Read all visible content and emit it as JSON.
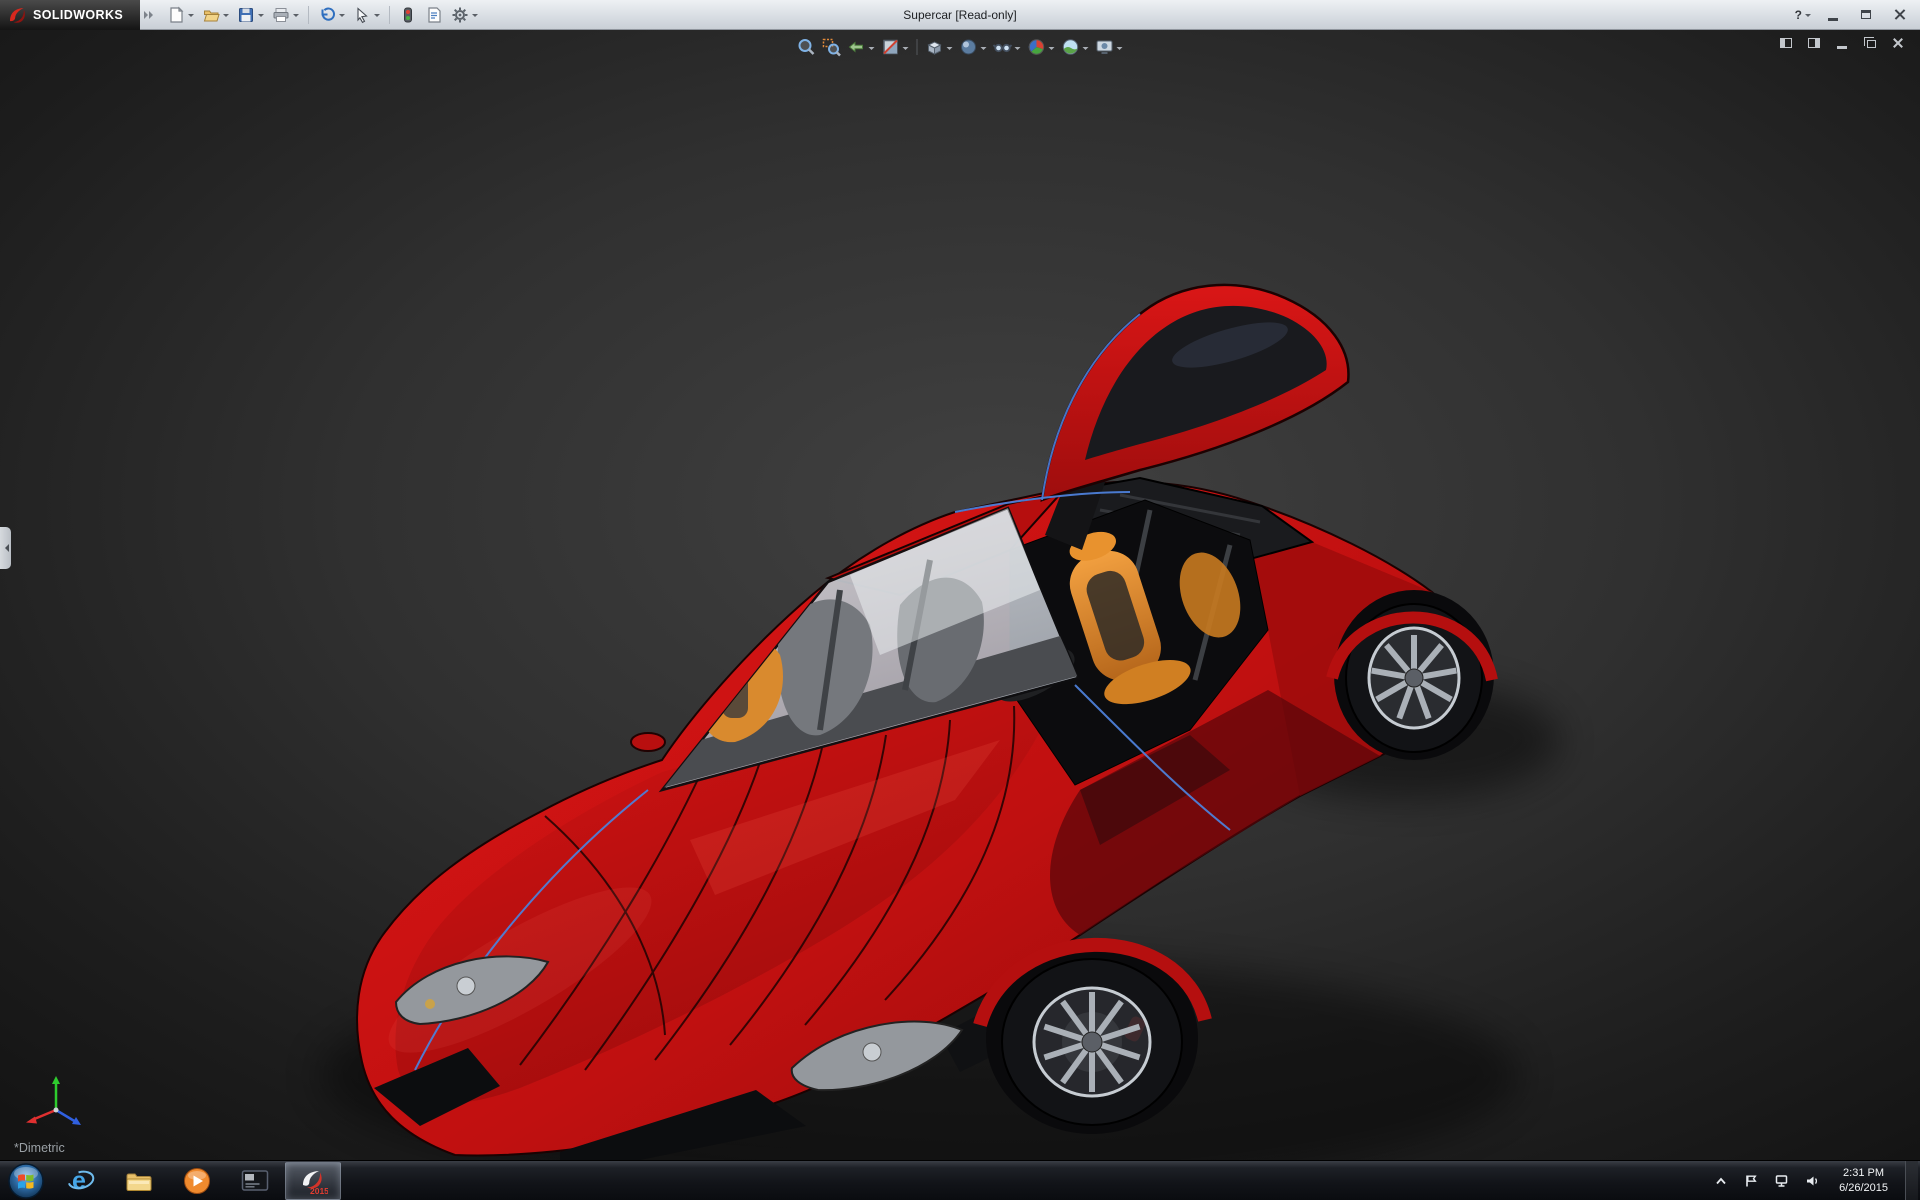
{
  "app": {
    "brand": "SOLIDWORKS",
    "title": "Supercar [Read-only]"
  },
  "titlebar": {
    "help_label": "?",
    "toolbar_items": [
      "new",
      "open",
      "save",
      "print",
      "undo",
      "select",
      "rebuild",
      "file-properties",
      "options"
    ],
    "window_controls": [
      "minimize",
      "maximize",
      "close"
    ]
  },
  "headsup_toolbar": {
    "items": [
      "zoom-to-fit",
      "zoom-to-area",
      "previous-view",
      "section-view",
      "view-orientation",
      "display-style",
      "hide-show-items",
      "edit-appearance",
      "apply-scene",
      "view-settings"
    ]
  },
  "document_controls": [
    "pane-left",
    "pane-right",
    "doc-minimize",
    "doc-restore",
    "doc-close"
  ],
  "viewport": {
    "view_label": "*Dimetric",
    "model": "red supercar, open gullwing door, orange sport seats",
    "colors": {
      "background_center": "#3f3f3f",
      "background_edge": "#141414",
      "car_body": "#c81010",
      "seats": "#e08a2e",
      "accent_edge_blue": "#4d7fd9"
    }
  },
  "taskbar": {
    "items": [
      {
        "name": "start"
      },
      {
        "name": "internet-explorer",
        "glyph": "e"
      },
      {
        "name": "file-explorer"
      },
      {
        "name": "media-player"
      },
      {
        "name": "console-window"
      },
      {
        "name": "solidworks-2015",
        "active": true,
        "badge": "2015"
      }
    ],
    "tray": {
      "icons": [
        "hidden-icons",
        "action-center",
        "network",
        "volume"
      ],
      "time": "2:31 PM",
      "date": "6/26/2015"
    }
  }
}
